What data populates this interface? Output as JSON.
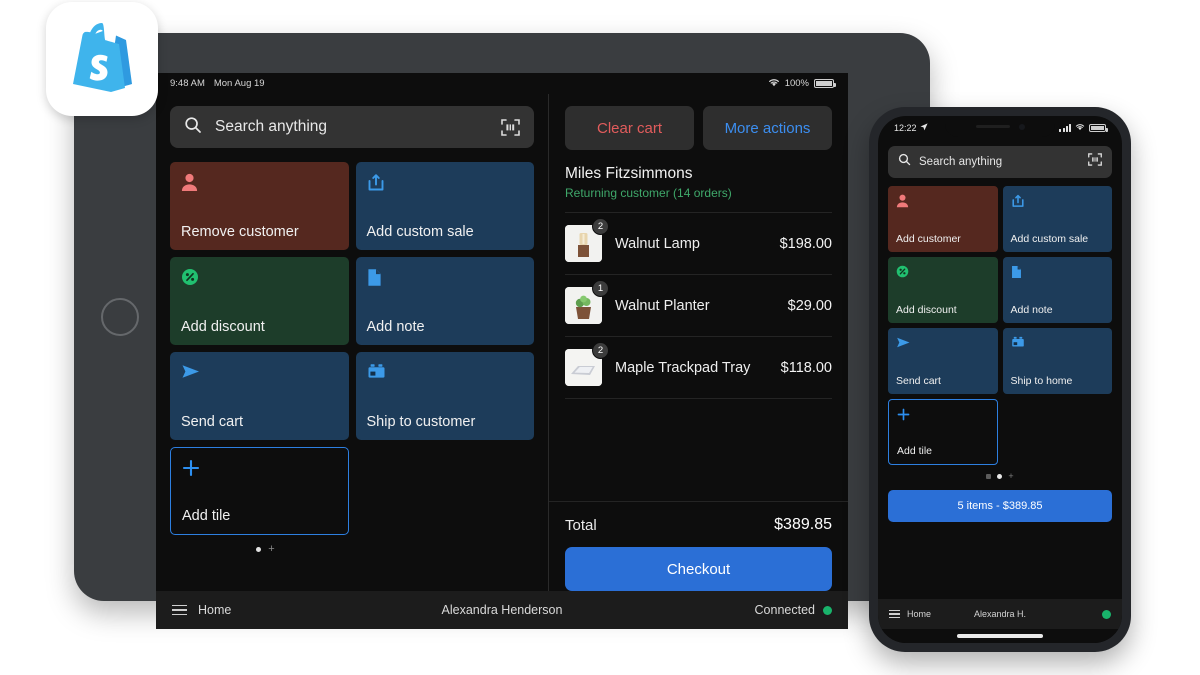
{
  "app": {
    "icon_name": "shopify-pos-app-icon"
  },
  "tablet": {
    "status_bar": {
      "time": "9:48 AM",
      "date": "Mon Aug 19",
      "wifi_icon": "wifi-icon",
      "battery_percent": "100%",
      "battery_icon": "battery-full-icon"
    },
    "search": {
      "icon": "search-icon",
      "placeholder": "Search anything",
      "scan_icon": "barcode-scan-icon"
    },
    "tiles": [
      {
        "label": "Remove customer",
        "color": "red",
        "icon": "customer-icon",
        "icon_color": "#f07a7a"
      },
      {
        "label": "Add custom sale",
        "color": "blue",
        "icon": "custom-sale-icon",
        "icon_color": "#3c9ae8"
      },
      {
        "label": "Add discount",
        "color": "green",
        "icon": "discount-icon",
        "icon_color": "#21c070"
      },
      {
        "label": "Add note",
        "color": "blue",
        "icon": "note-icon",
        "icon_color": "#3c9ae8"
      },
      {
        "label": "Send cart",
        "color": "blue",
        "icon": "send-icon",
        "icon_color": "#3c9ae8"
      },
      {
        "label": "Ship to customer",
        "color": "blue",
        "icon": "delivery-truck-icon",
        "icon_color": "#3c9ae8"
      }
    ],
    "add_tile": {
      "label": "Add tile",
      "icon": "plus-icon"
    },
    "cart": {
      "clear_label": "Clear cart",
      "more_label": "More actions",
      "customer_name": "Miles Fitzsimmons",
      "customer_status": "Returning customer (14 orders)",
      "items": [
        {
          "name": "Walnut Lamp",
          "qty": "2",
          "price": "$198.00",
          "thumb": "walnut-lamp-thumbnail"
        },
        {
          "name": "Walnut Planter",
          "qty": "1",
          "price": "$29.00",
          "thumb": "walnut-planter-thumbnail"
        },
        {
          "name": "Maple Trackpad Tray",
          "qty": "2",
          "price": "$118.00",
          "thumb": "maple-trackpad-tray-thumbnail"
        }
      ],
      "total_label": "Total",
      "total_value": "$389.85",
      "checkout_label": "Checkout"
    },
    "bottom_bar": {
      "menu_icon": "hamburger-menu-icon",
      "home_label": "Home",
      "staff_name": "Alexandra Henderson",
      "connection_label": "Connected",
      "connection_color": "#19b36b"
    }
  },
  "phone": {
    "status_bar": {
      "time": "12:22",
      "location_icon": "location-arrow-icon",
      "signal_icon": "cellular-signal-icon",
      "wifi_icon": "wifi-icon",
      "battery_icon": "battery-full-icon"
    },
    "search": {
      "icon": "search-icon",
      "placeholder": "Search anything",
      "scan_icon": "barcode-scan-icon"
    },
    "tiles": [
      {
        "label": "Add customer",
        "color": "red",
        "icon": "customer-icon",
        "icon_color": "#f07a7a"
      },
      {
        "label": "Add custom sale",
        "color": "blue",
        "icon": "custom-sale-icon",
        "icon_color": "#3c9ae8"
      },
      {
        "label": "Add discount",
        "color": "green",
        "icon": "discount-icon",
        "icon_color": "#21c070"
      },
      {
        "label": "Add note",
        "color": "blue",
        "icon": "note-icon",
        "icon_color": "#3c9ae8"
      },
      {
        "label": "Send cart",
        "color": "blue",
        "icon": "send-icon",
        "icon_color": "#3c9ae8"
      },
      {
        "label": "Ship to home",
        "color": "blue",
        "icon": "delivery-truck-icon",
        "icon_color": "#3c9ae8"
      }
    ],
    "add_tile": {
      "label": "Add tile",
      "icon": "plus-icon"
    },
    "cart_summary_label": "5 items - $389.85",
    "bottom_bar": {
      "menu_icon": "hamburger-menu-icon",
      "home_label": "Home",
      "staff_name": "Alexandra H.",
      "connection_color": "#19b36b"
    }
  },
  "colors": {
    "accent_blue": "#2b6fd6",
    "tile_red": "#55281f",
    "tile_blue": "#1d3c5a",
    "tile_green": "#1d3d2a",
    "screen_bg": "#0d0d0d",
    "danger_red": "#e25c5c",
    "link_blue": "#3c8ef0",
    "status_green": "#19b36b"
  }
}
